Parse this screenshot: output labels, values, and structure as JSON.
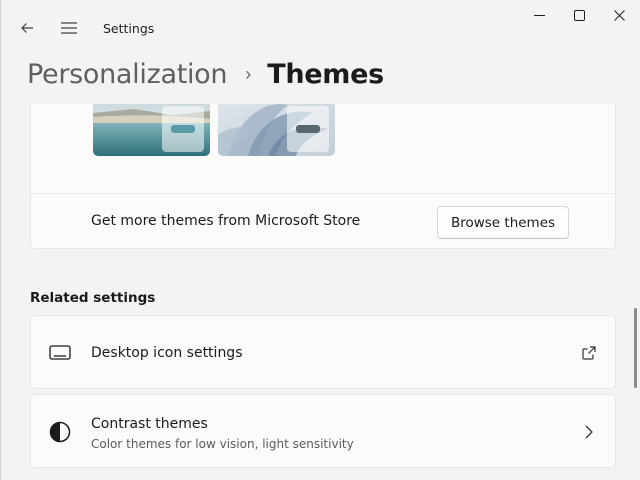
{
  "window": {
    "title": "Settings",
    "back_icon": "back-arrow-icon",
    "menu_icon": "hamburger-menu-icon",
    "controls": [
      "minimize-icon",
      "maximize-icon",
      "close-icon"
    ]
  },
  "header": {
    "parent": "Personalization",
    "separator": "›",
    "current": "Themes"
  },
  "themes_card": {
    "thumbnails": [
      {
        "name": "lake-theme",
        "accent": "#5a9ba8"
      },
      {
        "name": "bloom-theme",
        "accent": "#5a6670"
      }
    ],
    "store_text": "Get more themes from Microsoft Store",
    "browse_label": "Browse themes"
  },
  "related": {
    "title": "Related settings",
    "items": [
      {
        "title": "Desktop icon settings",
        "subtitle": "",
        "icon": "desktop-icon",
        "trail_icon": "open-external-icon"
      },
      {
        "title": "Contrast themes",
        "subtitle": "Color themes for low vision, light sensitivity",
        "icon": "contrast-icon",
        "trail_icon": "chevron-right-icon"
      }
    ]
  },
  "colors": {
    "background": "#f3f3f3",
    "card": "#fbfbfb",
    "text_primary": "#1b1b1b",
    "text_secondary": "#5c5c5c"
  }
}
